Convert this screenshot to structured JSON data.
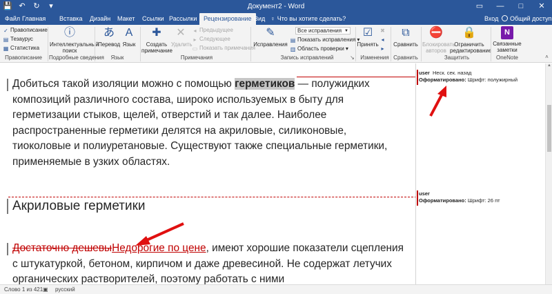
{
  "window": {
    "title": "Документ2 - Word",
    "minimize": "—",
    "restore": "□",
    "close": "✕",
    "ribbon_options": "▭"
  },
  "qat": {
    "save": "💾",
    "undo": "↶",
    "redo": "↻",
    "customize": "▾"
  },
  "tabs": [
    "Файл",
    "Главная",
    "Вставка",
    "Дизайн",
    "Макет",
    "Ссылки",
    "Рассылки",
    "Рецензирование",
    "Вид"
  ],
  "active_tab": "Рецензирование",
  "tell_me": "Что вы хотите сделать?",
  "sign_in": "Вход",
  "share": "Общий доступ",
  "ribbon": {
    "proofing": {
      "spelling": "Правописание",
      "thesaurus": "Тезаурус",
      "stats": "Статистика",
      "label": "Правописание"
    },
    "insights": {
      "smart_lookup": "Интеллектуальный поиск",
      "label": "Подробные сведения"
    },
    "language": {
      "translate": "Перевод",
      "language": "Язык",
      "label": "Язык"
    },
    "comments": {
      "new": "Создать примечание",
      "delete": "Удалить",
      "previous": "Предыдущее",
      "next": "Следующее",
      "show": "Показать примечания",
      "label": "Примечания"
    },
    "tracking": {
      "track_changes": "Исправления",
      "markup_select": "Все исправления",
      "show_markup": "Показать исправления",
      "reviewing_pane": "Область проверки",
      "label": "Запись исправлений"
    },
    "changes": {
      "accept": "Принять",
      "label": "Изменения"
    },
    "compare": {
      "compare": "Сравнить",
      "label": "Сравнить"
    },
    "protect": {
      "block_authors": "Блокировать авторов",
      "restrict": "Ограничить редактирование",
      "label": "Защитить"
    },
    "onenote": {
      "linked_notes": "Связанные заметки",
      "label": "OneNote"
    }
  },
  "document": {
    "para1_before": "Добиться такой изоляции можно с помощью ",
    "para1_highlight": "герметиков",
    "para1_after": " — полужидких композиций различного состава, широко используемых в быту для герметизации стыков, щелей, отверстий и так далее. Наиболее распространенные герметики делятся на акриловые, силиконовые, тиоколовые и полиуретановые. Существуют также специальные герметики, применяемые в узких областях.",
    "heading": "Акриловые герметики",
    "para2_deleted": "Достаточно дешевы",
    "para2_inserted": "Недорогие по цене",
    "para2_after": ", имеют хорошие показатели сцепления с штукатуркой, бетоном, кирпичом и даже древесиной. Не содержат летучих органических растворителей, поэтому работать с ними"
  },
  "balloons": [
    {
      "author": "user",
      "time": "Неск. сек. назад",
      "action": "Оформатировано:",
      "detail": "Шрифт: полужирный"
    },
    {
      "author": "user",
      "time": "",
      "action": "Оформатировано:",
      "detail": "Шрифт: 26 пт"
    }
  ],
  "status": {
    "page": "Слово 1 из 421",
    "lang": "русский"
  },
  "colors": {
    "word_blue": "#2b579a",
    "revision_red": "#c00000",
    "arrow_red": "#e01010"
  }
}
